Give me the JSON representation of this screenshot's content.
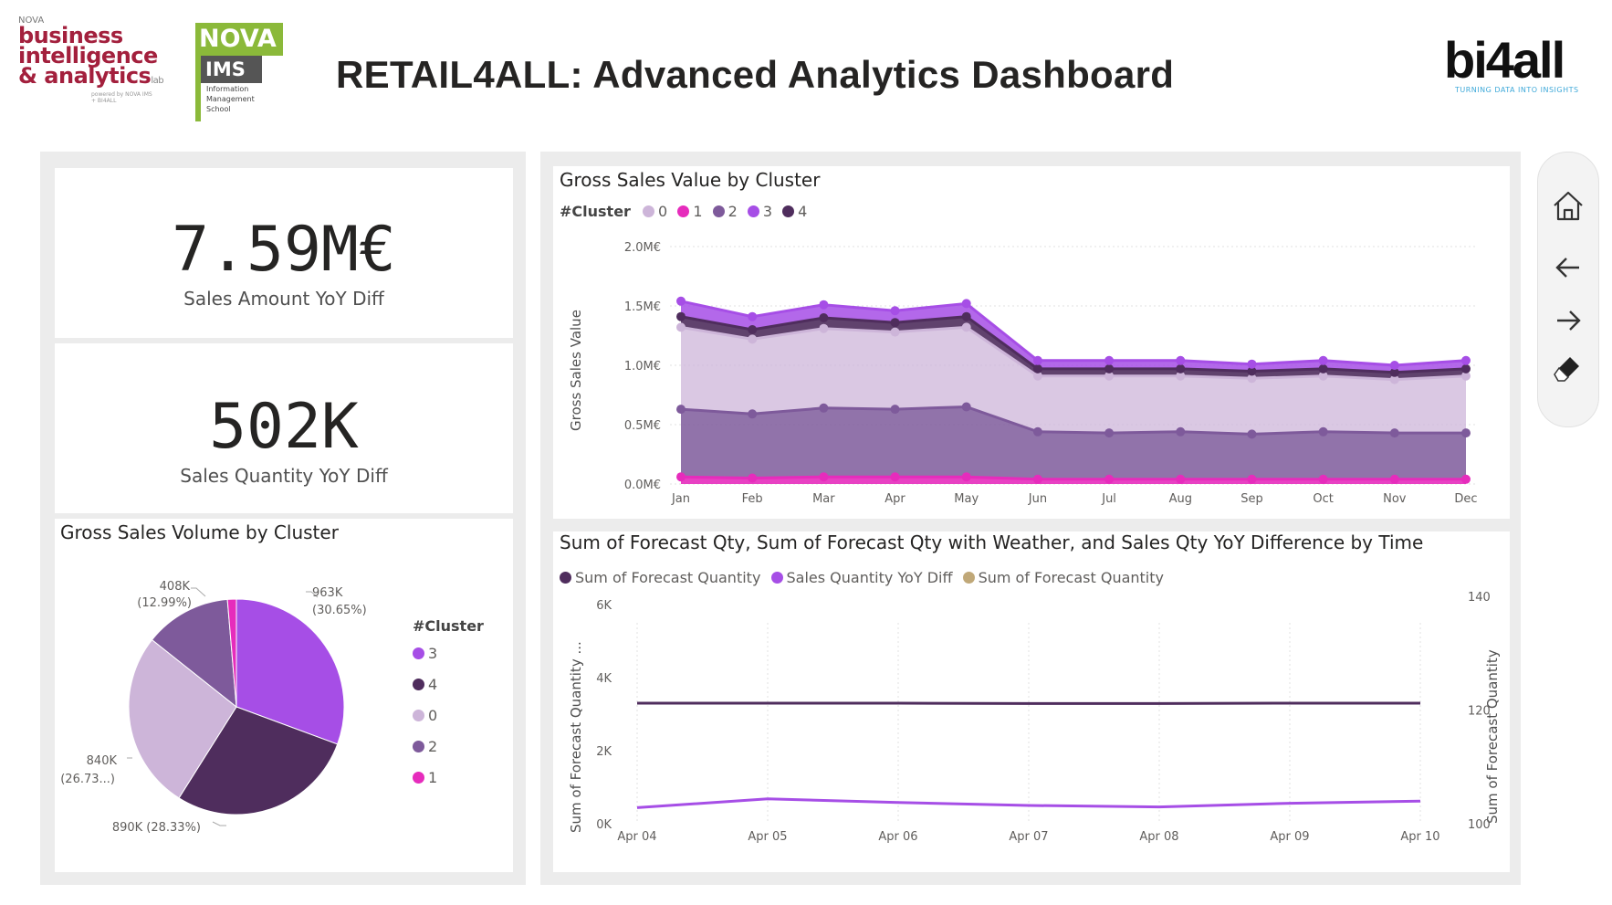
{
  "header": {
    "title": "RETAIL4ALL: Advanced Analytics Dashboard",
    "logo_nova_bi": {
      "top": "NOVA",
      "line1": "business",
      "line2": "intelligence",
      "line3": "& analytics",
      "suffix": "lab",
      "credit1": "powered by NOVA IMS",
      "credit2": "+ BI4ALL"
    },
    "logo_ims": {
      "top": "NOVA",
      "mid": "IMS",
      "sub1": "Information",
      "sub2": "Management",
      "sub3": "School"
    },
    "logo_bi4all": {
      "word": "bi4all",
      "tagline": "TURNING DATA INTO INSIGHTS"
    }
  },
  "kpis": [
    {
      "value": "7.59M€",
      "label": "Sales Amount YoY Diff"
    },
    {
      "value": "502K",
      "label": "Sales Quantity YoY Diff"
    }
  ],
  "pie": {
    "title": "Gross Sales Volume by Cluster",
    "legend_title": "#Cluster",
    "colors": {
      "3": "#a64ee6",
      "4": "#4f2d5d",
      "0": "#cdb5d9",
      "2": "#7e5a9b",
      "1": "#e62cbc"
    },
    "legend": [
      "3",
      "4",
      "0",
      "2",
      "1"
    ],
    "labels": {
      "c3": {
        "value": "963K",
        "pct": "(30.65%)"
      },
      "c4": {
        "text": "890K (28.33%)"
      },
      "c0": {
        "value": "840K",
        "pct": "(26.73...)"
      },
      "c2": {
        "value": "408K",
        "pct": "(12.99%)"
      }
    }
  },
  "area_chart": {
    "title": "Gross Sales Value by Cluster",
    "legend_title": "#Cluster",
    "legend": [
      {
        "name": "0",
        "color": "#cdb5d9"
      },
      {
        "name": "1",
        "color": "#e62cbc"
      },
      {
        "name": "2",
        "color": "#7e5a9b"
      },
      {
        "name": "3",
        "color": "#a64ee6"
      },
      {
        "name": "4",
        "color": "#4f2d5d"
      }
    ],
    "y_axis_title": "Gross Sales Value"
  },
  "line_chart": {
    "title": "Sum of Forecast Qty, Sum of Forecast Qty with Weather, and Sales Qty YoY Difference by Time",
    "legend": [
      {
        "name": "Sum of Forecast Quantity",
        "color": "#4f2d5d"
      },
      {
        "name": "Sales Quantity YoY Diff",
        "color": "#a64ee6"
      },
      {
        "name": "Sum of Forecast Quantity",
        "color": "#c0a878"
      }
    ],
    "y_left_title": "Sum of Forecast Quantity ...",
    "y_right_title": "Sum of Forecast Quantity"
  },
  "chart_data": [
    {
      "type": "pie",
      "title": "Gross Sales Volume by Cluster",
      "legend_title": "#Cluster",
      "categories": [
        "3",
        "4",
        "0",
        "2",
        "1"
      ],
      "values": [
        963000,
        890000,
        840000,
        408000,
        42000
      ],
      "percent": [
        30.65,
        28.33,
        26.73,
        12.99,
        1.3
      ]
    },
    {
      "type": "area",
      "title": "Gross Sales Value by Cluster",
      "stacked": true,
      "categories": [
        "Jan",
        "Feb",
        "Mar",
        "Apr",
        "May",
        "Jun",
        "Jul",
        "Aug",
        "Sep",
        "Oct",
        "Nov",
        "Dec"
      ],
      "ylabel": "Gross Sales Value",
      "ylim": [
        0,
        2.0
      ],
      "yticks": [
        "0.0M€",
        "0.5M€",
        "1.0M€",
        "1.5M€",
        "2.0M€"
      ],
      "unit": "M€",
      "series": [
        {
          "name": "1",
          "values": [
            0.06,
            0.05,
            0.06,
            0.06,
            0.06,
            0.04,
            0.04,
            0.04,
            0.04,
            0.04,
            0.04,
            0.04
          ]
        },
        {
          "name": "2",
          "values": [
            0.57,
            0.54,
            0.58,
            0.57,
            0.59,
            0.4,
            0.39,
            0.4,
            0.38,
            0.4,
            0.39,
            0.39
          ]
        },
        {
          "name": "0",
          "values": [
            0.69,
            0.63,
            0.67,
            0.65,
            0.67,
            0.47,
            0.48,
            0.47,
            0.47,
            0.47,
            0.45,
            0.48
          ]
        },
        {
          "name": "4",
          "values": [
            0.09,
            0.08,
            0.09,
            0.08,
            0.09,
            0.06,
            0.06,
            0.06,
            0.06,
            0.06,
            0.06,
            0.06
          ]
        },
        {
          "name": "3",
          "values": [
            0.13,
            0.11,
            0.11,
            0.1,
            0.11,
            0.07,
            0.07,
            0.07,
            0.06,
            0.07,
            0.06,
            0.07
          ]
        }
      ]
    },
    {
      "type": "line",
      "title": "Sum of Forecast Qty, Sum of Forecast Qty with Weather, and Sales Qty YoY Difference by Time",
      "x": [
        "Apr 04",
        "Apr 05",
        "Apr 06",
        "Apr 07",
        "Apr 08",
        "Apr 09",
        "Apr 10"
      ],
      "ylabel": "Sum of Forecast Quantity ...",
      "ylim": [
        0,
        7000
      ],
      "yticks": [
        "0K",
        "2K",
        "4K",
        "6K"
      ],
      "y2label": "Sum of Forecast Quantity",
      "y2lim": [
        100,
        145
      ],
      "y2ticks": [
        "100",
        "120",
        "140"
      ],
      "series": [
        {
          "name": "Sum of Forecast Quantity",
          "axis": "left",
          "values": [
            3300,
            3300,
            3300,
            3290,
            3290,
            3300,
            3300
          ]
        },
        {
          "name": "Sales Quantity YoY Diff",
          "axis": "left",
          "values": [
            440,
            680,
            580,
            500,
            460,
            560,
            620
          ]
        }
      ]
    }
  ],
  "nav": {
    "home": "home-icon",
    "back": "arrow-left-icon",
    "forward": "arrow-right-icon",
    "clear": "eraser-icon"
  }
}
